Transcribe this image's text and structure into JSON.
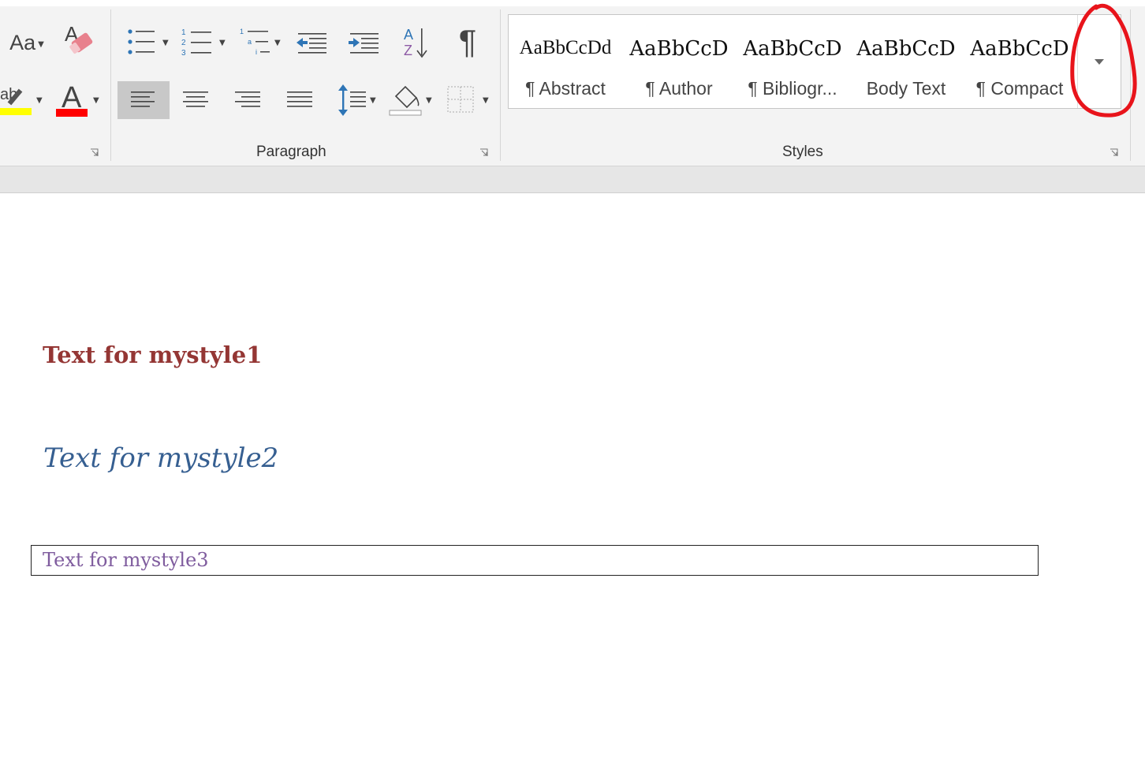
{
  "ribbon": {
    "font_group": {
      "change_case_label": "Aa",
      "highlight_glyph": "ab",
      "font_color_glyph": "A",
      "highlight_color": "#ffff00",
      "font_color": "#ff0000"
    },
    "paragraph": {
      "label": "Paragraph",
      "sort_glyph_top": "A",
      "sort_glyph_bottom": "Z",
      "pilcrow_glyph": "¶"
    },
    "styles": {
      "label": "Styles",
      "items": [
        {
          "preview": "AaBbCcDd",
          "name": "¶ Abstract"
        },
        {
          "preview": "AaBbCcD",
          "name": "¶ Author"
        },
        {
          "preview": "AaBbCcD",
          "name": "¶ Bibliogr..."
        },
        {
          "preview": "AaBbCcD",
          "name": "Body Text"
        },
        {
          "preview": "AaBbCcD",
          "name": "¶ Compact"
        }
      ]
    }
  },
  "document": {
    "line1": "Text for mystyle1",
    "line2": "Text for mystyle2",
    "line3": "Text for mystyle3"
  },
  "colors": {
    "mystyle1": "#943634",
    "mystyle2": "#365f91",
    "mystyle3": "#7f5c9e",
    "annotation": "#e8141b",
    "icon_blue": "#2e75b6"
  },
  "icons": [
    "change-case-icon",
    "clear-formatting-icon",
    "highlight-icon",
    "font-color-icon",
    "bullets-icon",
    "numbering-icon",
    "multilevel-list-icon",
    "decrease-indent-icon",
    "increase-indent-icon",
    "sort-icon",
    "show-formatting-marks-icon",
    "align-left-icon",
    "center-icon",
    "align-right-icon",
    "justify-icon",
    "line-spacing-icon",
    "shading-icon",
    "borders-icon",
    "dialog-launcher-icon",
    "chevron-down-icon"
  ]
}
